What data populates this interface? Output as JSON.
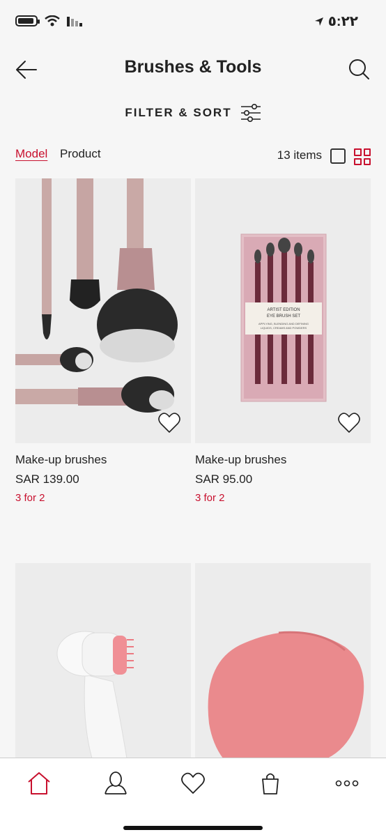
{
  "status": {
    "time": "٥:٢٢"
  },
  "header": {
    "title": "Brushes & Tools"
  },
  "filter": {
    "label": "FILTER & SORT"
  },
  "view": {
    "model_label": "Model",
    "product_label": "Product",
    "item_count": "13 items"
  },
  "products": [
    {
      "name": "Make-up brushes",
      "price": "SAR 139.00",
      "promo": "3 for 2"
    },
    {
      "name": "Make-up brushes",
      "price": "SAR 95.00",
      "promo": "3 for 2"
    },
    {
      "name": "",
      "price": "",
      "promo": ""
    },
    {
      "name": "",
      "price": "",
      "promo": ""
    }
  ],
  "packaging": {
    "line1": "ARTIST EDITION",
    "line2": "EYE BRUSH SET",
    "line3": "APPLYING, BLENDING AND DEFINING",
    "line4": "LIQUIDS, CREAMS AND POWDERS"
  },
  "colors": {
    "accent": "#c8102e",
    "text": "#222222",
    "background": "#f6f6f6"
  },
  "icons": [
    "back-arrow-icon",
    "search-icon",
    "filter-sliders-icon",
    "heart-icon",
    "home-icon",
    "account-icon",
    "favorites-icon",
    "bag-icon",
    "more-icon"
  ]
}
